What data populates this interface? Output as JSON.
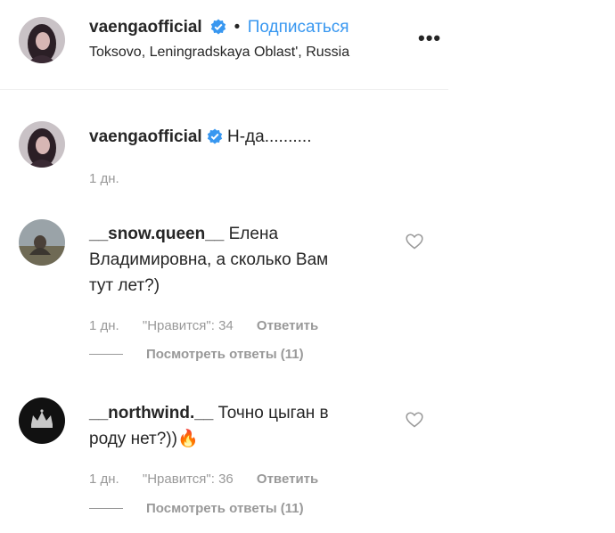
{
  "header": {
    "username": "vaengaofficial",
    "separator": "•",
    "follow_label": "Подписаться",
    "location": "Toksovo, Leningradskaya Oblast', Russia",
    "more_label": "•••"
  },
  "caption": {
    "username": "vaengaofficial",
    "text": "Н-да..........",
    "time": "1 дн."
  },
  "comments": [
    {
      "username": "__snow.queen__",
      "text_line1": " Елена",
      "text_line2": "Владимировна, а сколько Вам",
      "text_line3": "тут лет?)",
      "time": "1 дн.",
      "likes": "\"Нравится\": 34",
      "reply_label": "Ответить",
      "view_replies": "Посмотреть ответы (11)"
    },
    {
      "username": "__northwind.__",
      "text_line1": " Точно цыган в",
      "text_line2": "роду нет?))",
      "emoji": "🔥",
      "time": "1 дн.",
      "likes": "\"Нравится\": 36",
      "reply_label": "Ответить",
      "view_replies": "Посмотреть ответы (11)"
    }
  ],
  "colors": {
    "link": "#3897f0",
    "meta": "#999999",
    "text": "#262626"
  }
}
